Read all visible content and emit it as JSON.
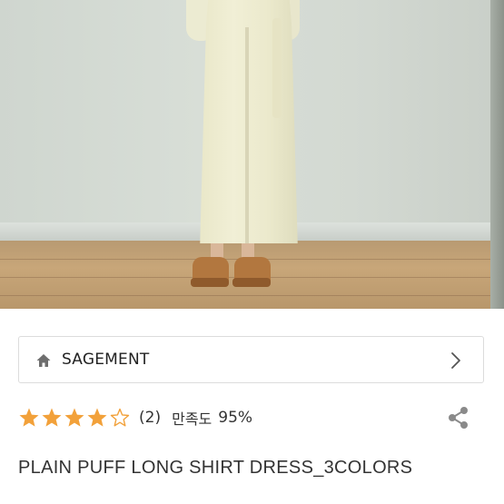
{
  "product_image": {
    "alt": "product-photo"
  },
  "brand": {
    "name": "SAGEMENT",
    "icon": "home-icon",
    "action_icon": "chevron-right-icon"
  },
  "rating": {
    "stars": 4.5,
    "max_stars": 5,
    "review_count": "(2)",
    "satisfaction_label": "만족도",
    "satisfaction_value": "95%",
    "star_color": "#f2a13a"
  },
  "share": {
    "icon": "share-icon"
  },
  "product": {
    "title": "PLAIN PUFF LONG SHIRT DRESS_3COLORS"
  }
}
